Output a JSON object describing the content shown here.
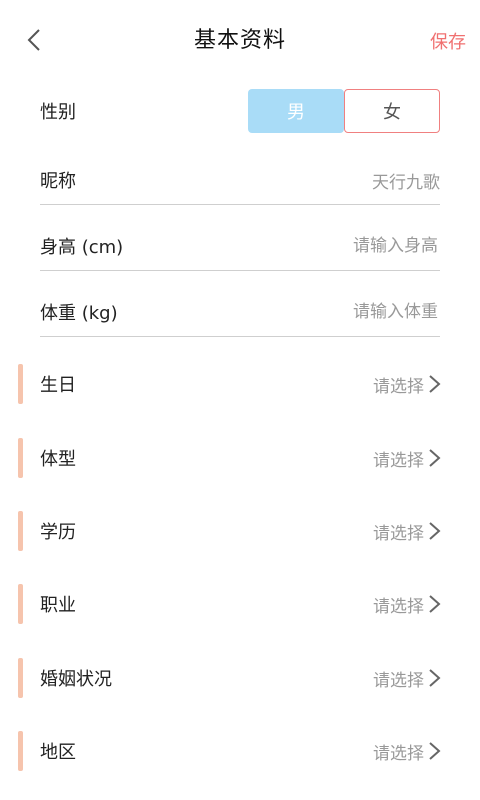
{
  "header": {
    "title": "基本资料",
    "save_label": "保存",
    "back_icon": "chevron-left-icon",
    "save_color": "#f07070"
  },
  "gender": {
    "label": "性别",
    "options": [
      "男",
      "女"
    ],
    "selected": "男",
    "selected_color": "#a9dcf7",
    "unselected_border_color": "#f08080"
  },
  "nickname": {
    "label": "昵称",
    "value": "天行九歌"
  },
  "height": {
    "label": "身高 (cm)",
    "placeholder": "请输入身高"
  },
  "weight": {
    "label": "体重 (kg)",
    "placeholder": "请输入体重"
  },
  "select_items": [
    {
      "label": "生日",
      "value": "请选择"
    },
    {
      "label": "体型",
      "value": "请选择"
    },
    {
      "label": "学历",
      "value": "请选择"
    },
    {
      "label": "职业",
      "value": "请选择"
    },
    {
      "label": "婚姻状况",
      "value": "请选择"
    },
    {
      "label": "地区",
      "value": "请选择"
    }
  ],
  "accent_color": "#f6c4ad"
}
